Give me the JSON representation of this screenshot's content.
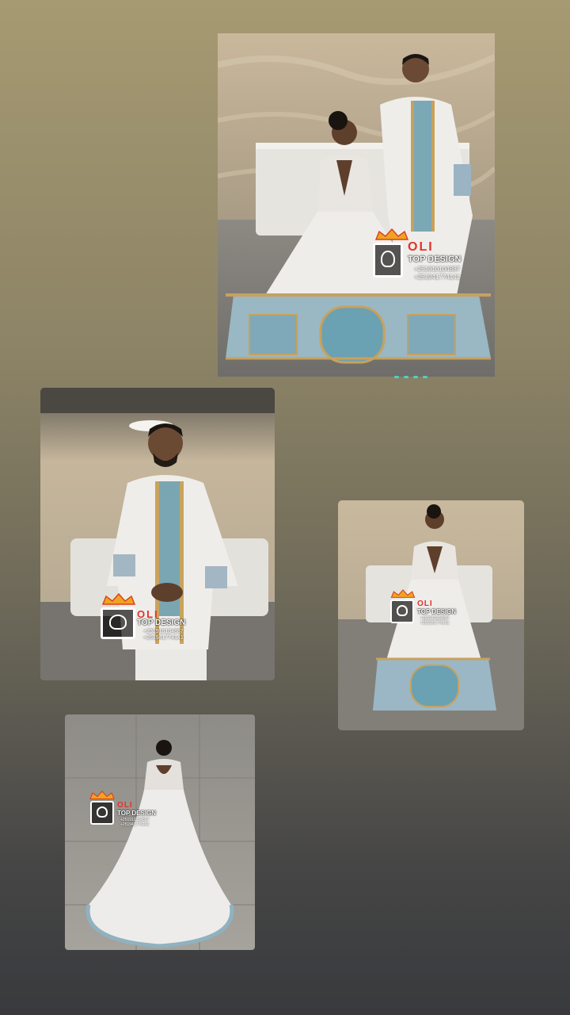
{
  "watermark": {
    "brand": "OLI",
    "name": "TOP DESIGN",
    "phone1": "+251910104887",
    "phone2": "+251941774141"
  },
  "photos": [
    {
      "name": "couple",
      "subject": "Couple in matching white embroidered habesha wedding attire"
    },
    {
      "name": "groom",
      "subject": "Groom in white embroidered jacket"
    },
    {
      "name": "bride-front",
      "subject": "Bride in white embroidered ball gown, front view"
    },
    {
      "name": "bride-back",
      "subject": "Bride in white gown with long train, back view"
    }
  ],
  "colors": {
    "background_top": "#a69a72",
    "background_bottom": "#393a3d",
    "watermark_red": "#e2322a",
    "story_progress": "#4fd1c7"
  }
}
